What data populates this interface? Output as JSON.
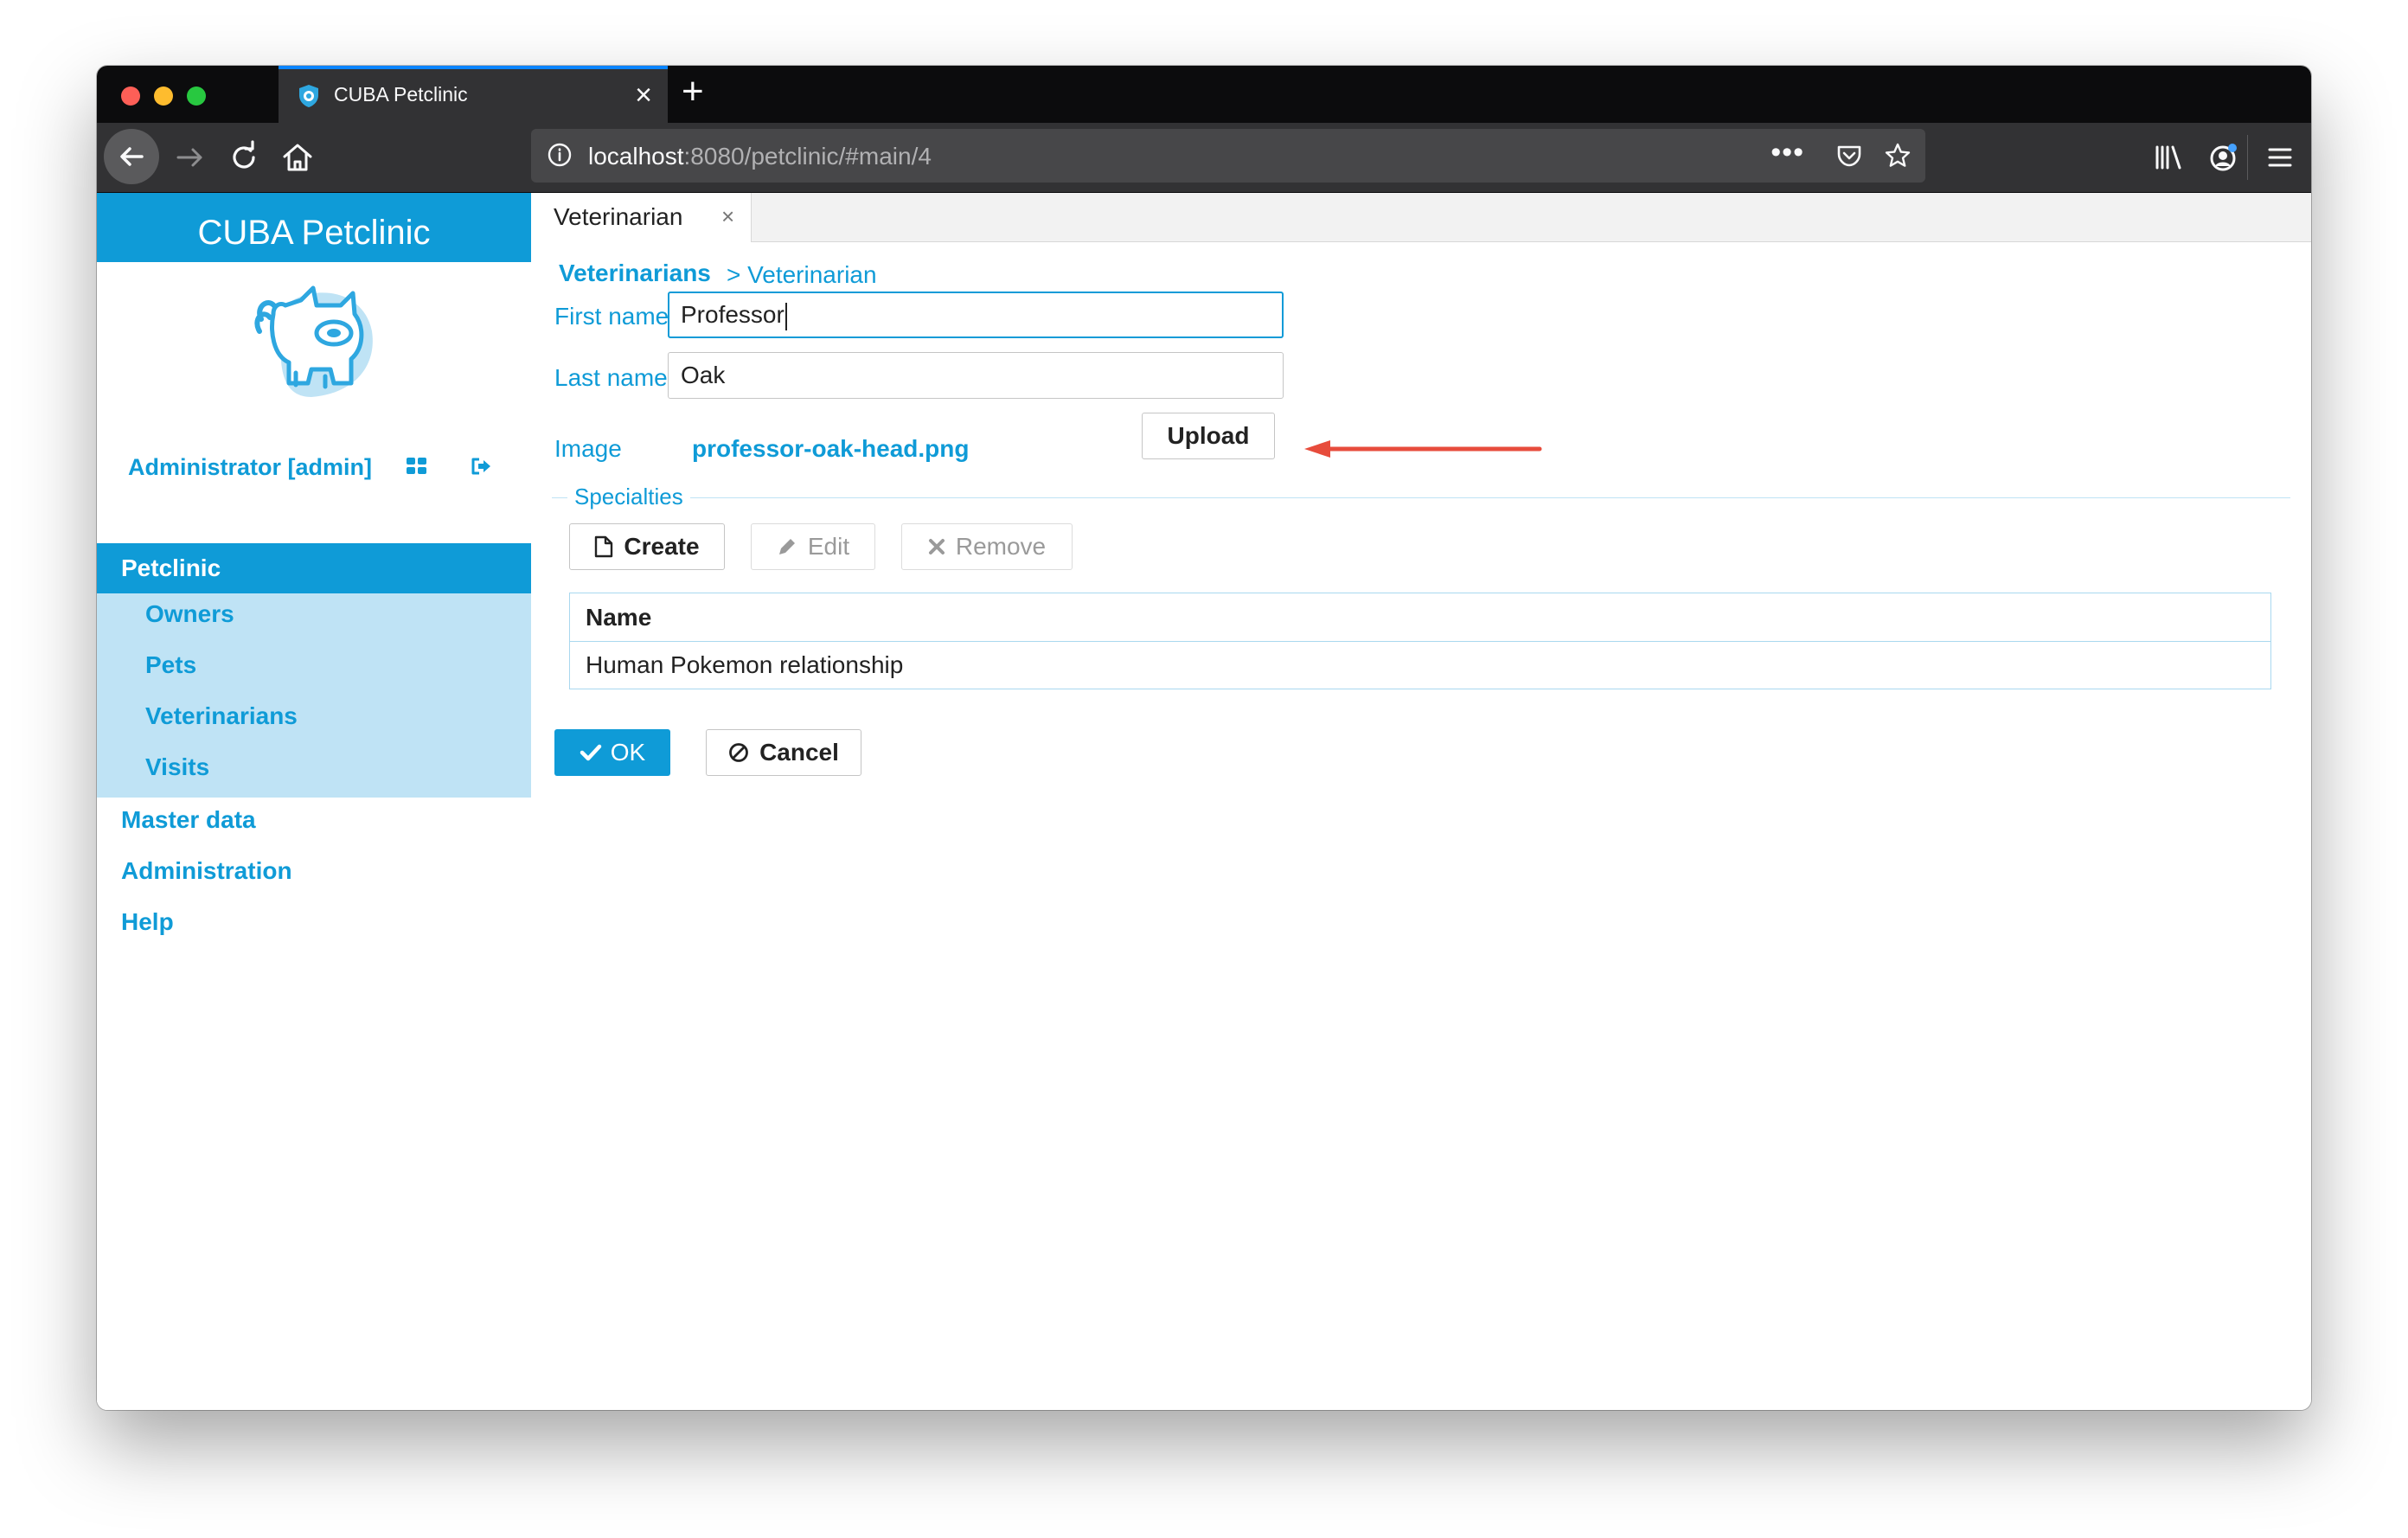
{
  "browser": {
    "tab_title": "CUBA Petclinic",
    "tab_close": "×",
    "new_tab": "+",
    "url_host": "localhost",
    "url_rest": ":8080/petclinic/#main/4",
    "url_more": "•••"
  },
  "sidebar": {
    "brand": "CUBA Petclinic",
    "user": "Administrator [admin]",
    "menu_head": "Petclinic",
    "submenu": [
      {
        "label": "Owners"
      },
      {
        "label": "Pets"
      },
      {
        "label": "Veterinarians"
      },
      {
        "label": "Visits"
      }
    ],
    "menu": [
      {
        "label": "Master data"
      },
      {
        "label": "Administration"
      },
      {
        "label": "Help"
      }
    ]
  },
  "main": {
    "tab_label": "Veterinarian",
    "tab_close": "×",
    "breadcrumb_root": "Veterinarians",
    "breadcrumb_current": "> Veterinarian",
    "form": {
      "first_name_label": "First name",
      "first_name_value": "Professor",
      "last_name_label": "Last name",
      "last_name_value": "Oak",
      "image_label": "Image",
      "image_file": "professor-oak-head.png",
      "upload_label": "Upload"
    },
    "specialties": {
      "legend": "Specialties",
      "create_label": "Create",
      "edit_label": "Edit",
      "remove_label": "Remove",
      "column_name": "Name",
      "rows": [
        {
          "name": "Human Pokemon relationship"
        }
      ]
    },
    "ok_label": "OK",
    "cancel_label": "Cancel"
  },
  "colors": {
    "accent": "#0f9bd7",
    "submenu_bg": "#bfe3f5",
    "annotation_arrow": "#e74c3c"
  }
}
